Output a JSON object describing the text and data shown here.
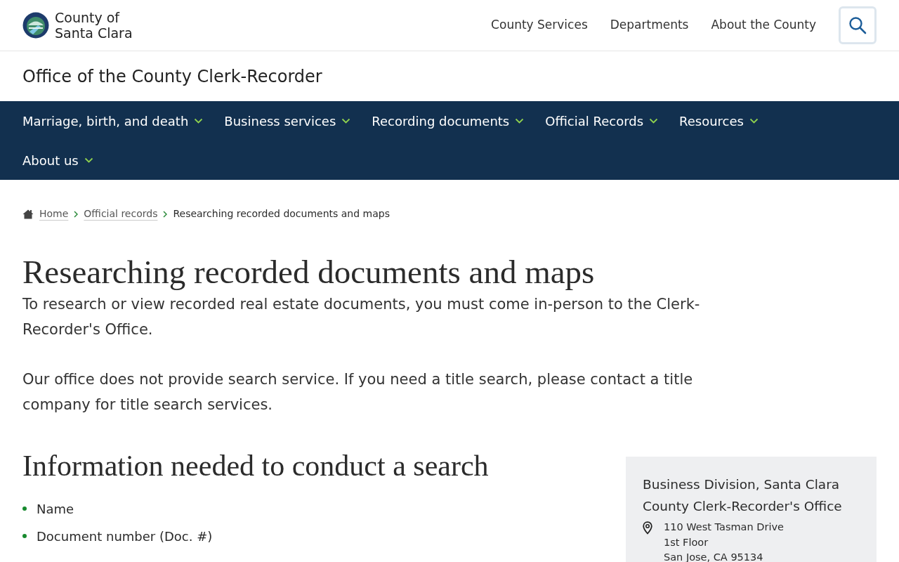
{
  "header": {
    "logo_line_1": "County of",
    "logo_line_2": "Santa Clara",
    "nav": [
      "County Services",
      "Departments",
      "About the County"
    ]
  },
  "office_title": "Office of the County Clerk-Recorder",
  "menu": [
    {
      "label": "Marriage, birth, and death"
    },
    {
      "label": "Business services"
    },
    {
      "label": "Recording documents"
    },
    {
      "label": "Official Records"
    },
    {
      "label": "Resources"
    },
    {
      "label": "About us"
    }
  ],
  "breadcrumb": [
    {
      "label": "Home",
      "kind": "link"
    },
    {
      "label": "Official records",
      "kind": "link"
    },
    {
      "label": "Researching recorded documents and maps",
      "kind": "current"
    }
  ],
  "title": "Researching recorded documents and maps",
  "paragraphs": [
    "To research or view recorded real estate documents, you must come in-person to the Clerk-Recorder's Office.",
    "Our office does not provide search service. If you need a title search, please contact a title company for title search services."
  ],
  "section_heading": "Information needed to conduct a search",
  "list": [
    "Name",
    "Document number (Doc. #)"
  ],
  "contact": {
    "title": "Business Division, Santa Clara County Clerk-Recorder's Office",
    "address": [
      "110 West Tasman Drive",
      "1st Floor",
      "San Jose, CA 95134"
    ]
  }
}
